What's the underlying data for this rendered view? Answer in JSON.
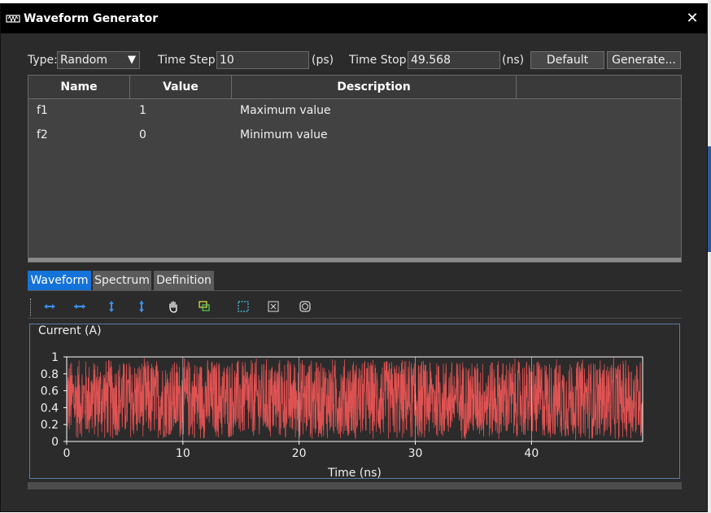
{
  "window": {
    "title": "Waveform Generator",
    "close_glyph": "✕"
  },
  "controls": {
    "type_label": "Type:",
    "type_value": "Random",
    "time_step_label": "Time Step:",
    "time_step_value": "10",
    "time_step_unit": "(ps)",
    "time_stop_label": "Time Stop:",
    "time_stop_value": "49.568",
    "time_stop_unit": "(ns)",
    "default_button": "Default",
    "generate_button": "Generate..."
  },
  "table": {
    "columns": [
      "Name",
      "Value",
      "Description"
    ],
    "rows": [
      {
        "name": "f1",
        "value": "1",
        "description": "Maximum value"
      },
      {
        "name": "f2",
        "value": "0",
        "description": "Minimum value"
      }
    ]
  },
  "tabs": [
    {
      "label": "Waveform",
      "active": true
    },
    {
      "label": "Spectrum",
      "active": false
    },
    {
      "label": "Definition",
      "active": false
    }
  ],
  "toolbar": {
    "icons": [
      "zoom-in-x-icon",
      "zoom-out-x-icon",
      "zoom-in-y-icon",
      "zoom-out-y-icon",
      "pan-hand-icon",
      "zoom-box-icon",
      "select-region-icon",
      "fit-all-icon",
      "reset-view-icon"
    ]
  },
  "chart_data": {
    "type": "line",
    "title": "",
    "ylabel": "Current (A)",
    "xlabel": "Time (ns)",
    "xlim": [
      0,
      49.568
    ],
    "ylim": [
      0,
      1
    ],
    "x_ticks": [
      0,
      10,
      20,
      30,
      40
    ],
    "y_ticks": [
      0,
      0.2,
      0.4,
      0.6,
      0.8,
      1
    ],
    "y_tick_labels": [
      "0",
      "0.2",
      "0.4",
      "0.6",
      "0.8",
      "1"
    ],
    "grid": true,
    "series": [
      {
        "color": "#e05252",
        "description": "uniform random values between 0 and 1 sampled at 10 ps steps",
        "min": 0,
        "max": 1
      }
    ]
  },
  "colors": {
    "accent": "#1473d8",
    "waveform": "#e05252",
    "panel_bg": "#2b2b2b"
  }
}
